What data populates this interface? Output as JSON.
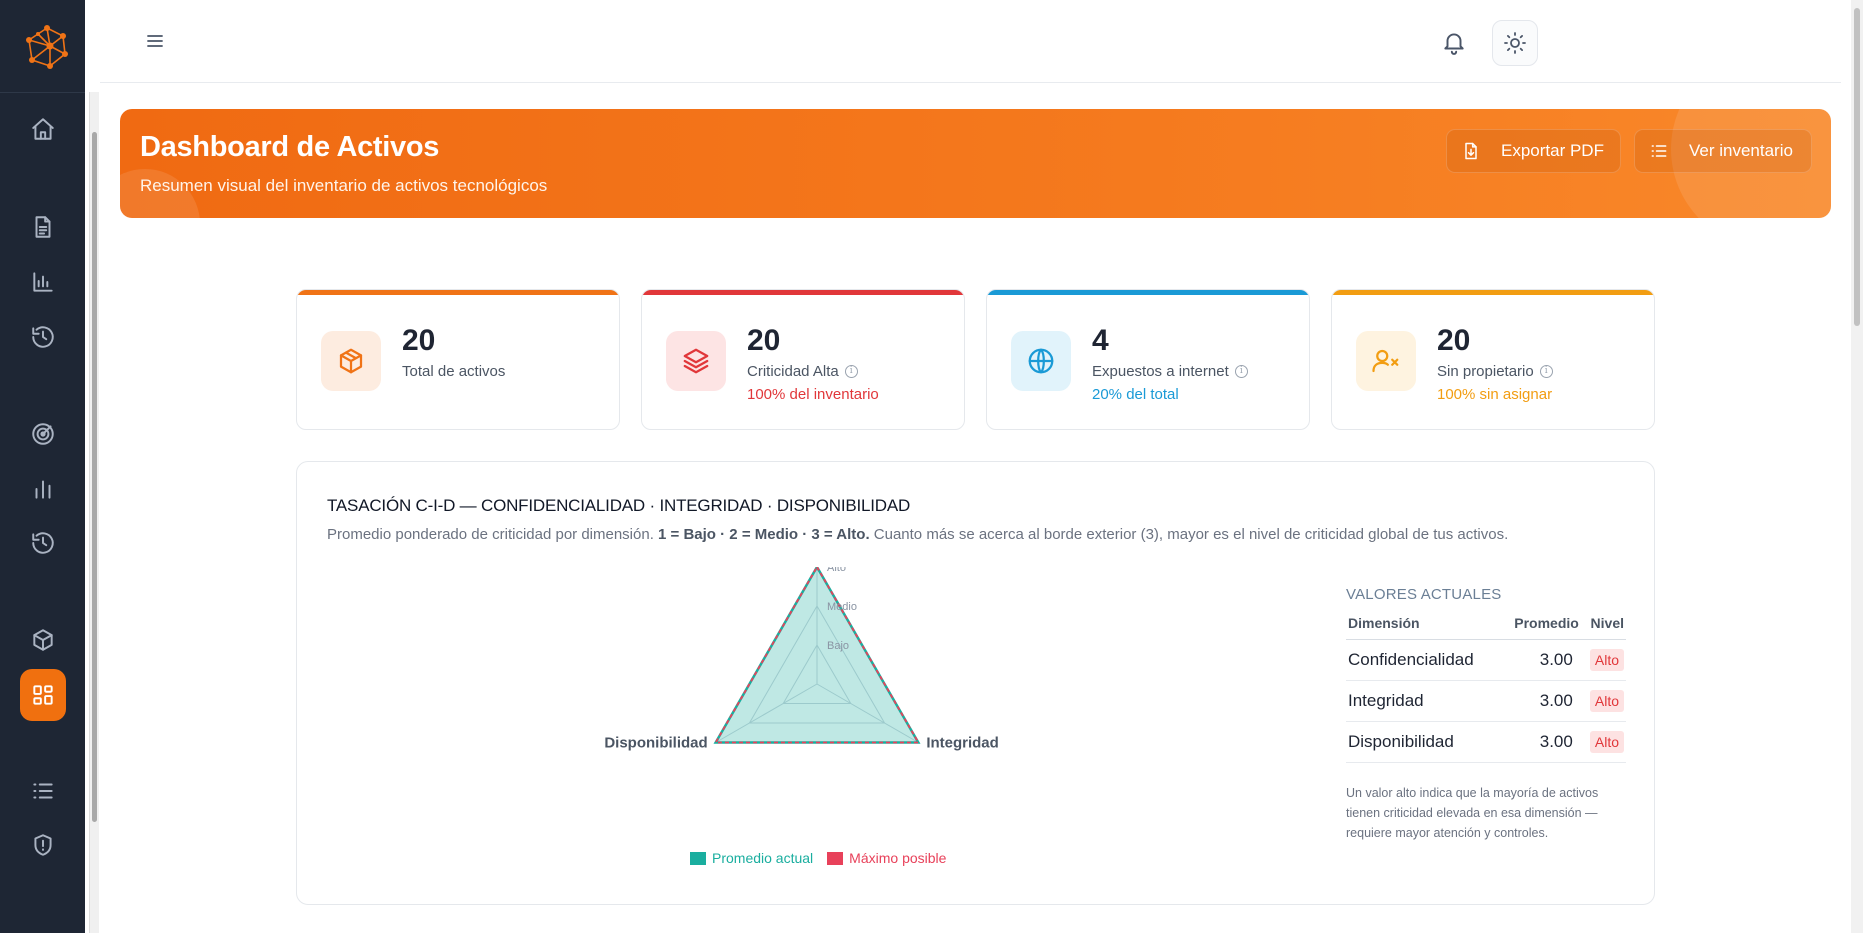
{
  "topbar": {
    "menu_icon": "menu-icon",
    "bell_icon": "bell-icon",
    "theme_icon": "sun-icon"
  },
  "sidebar": {
    "logo": "network-logo",
    "items": [
      {
        "icon": "home-icon"
      },
      {
        "icon": "document-icon"
      },
      {
        "icon": "bar-chart-icon"
      },
      {
        "icon": "history-icon"
      },
      {
        "icon": "radar-icon"
      },
      {
        "icon": "stats-icon"
      },
      {
        "icon": "history-icon"
      },
      {
        "icon": "box-icon"
      },
      {
        "icon": "dashboard-icon",
        "active": true
      },
      {
        "icon": "list-icon"
      },
      {
        "icon": "shield-alert-icon"
      }
    ]
  },
  "hero": {
    "title": "Dashboard de Activos",
    "subtitle": "Resumen visual del inventario de activos tecnológicos",
    "export_label": "Exportar PDF",
    "inventory_label": "Ver inventario"
  },
  "kpis": [
    {
      "value": "20",
      "label": "Total de activos",
      "sub": "",
      "color": "#f07316",
      "icon": "cube-icon"
    },
    {
      "value": "20",
      "label": "Criticidad Alta",
      "sub": "100% del inventario",
      "color": "#e1373a",
      "icon": "layers-icon"
    },
    {
      "value": "4",
      "label": "Expuestos a internet",
      "sub": "20% del total",
      "color": "#1a9ad6",
      "icon": "globe-icon"
    },
    {
      "value": "20",
      "label": "Sin propietario",
      "sub": "100% sin asignar",
      "color": "#f29d12",
      "icon": "user-x-icon"
    }
  ],
  "info_glyph": "i",
  "cid": {
    "title": "TASACIÓN C-I-D — CONFIDENCIALIDAD · INTEGRIDAD · DISPONIBILIDAD",
    "desc_prefix": "Promedio ponderado de criticidad por dimensión.",
    "desc_bold": "1 = Bajo · 2 = Medio · 3 = Alto.",
    "desc_suffix": "Cuanto más se acerca al borde exterior (3), mayor es el nivel de criticidad global de tus activos.",
    "values_title": "VALORES ACTUALES",
    "col_dimension": "Dimensión",
    "col_promedio": "Promedio",
    "col_nivel": "Nivel",
    "rows": [
      {
        "dimension": "Confidencialidad",
        "promedio": "3.00",
        "nivel": "Alto"
      },
      {
        "dimension": "Integridad",
        "promedio": "3.00",
        "nivel": "Alto"
      },
      {
        "dimension": "Disponibilidad",
        "promedio": "3.00",
        "nivel": "Alto"
      }
    ],
    "note": "Un valor alto indica que la mayoría de activos tienen criticidad elevada en esa dimensión — requiere mayor atención y controles."
  },
  "chart_data": {
    "type": "radar",
    "axes": [
      "Confidencialidad",
      "Integridad",
      "Disponibilidad"
    ],
    "scale_labels": [
      "Bajo",
      "Medio",
      "Alto"
    ],
    "rmax": 3,
    "series": [
      {
        "name": "Promedio actual",
        "values": [
          3,
          3,
          3
        ],
        "color": "#1aae9f"
      },
      {
        "name": "Máximo posible",
        "values": [
          3,
          3,
          3
        ],
        "color": "#e8415a"
      }
    ],
    "legend_position": "bottom"
  }
}
